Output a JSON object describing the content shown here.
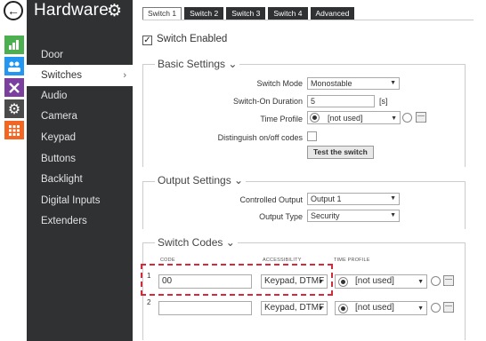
{
  "sidebar": {
    "title": "Hardware",
    "items": [
      {
        "label": "Door"
      },
      {
        "label": "Switches",
        "active": true
      },
      {
        "label": "Audio"
      },
      {
        "label": "Camera"
      },
      {
        "label": "Keypad"
      },
      {
        "label": "Buttons"
      },
      {
        "label": "Backlight"
      },
      {
        "label": "Digital Inputs"
      },
      {
        "label": "Extenders"
      }
    ]
  },
  "iconbar": {
    "colors": [
      "#4caf50",
      "#2196f3",
      "#7b3fa0",
      "#4a4a4a",
      "#f26522"
    ],
    "icons": [
      "bar-chart-icon",
      "users-icon",
      "tools-icon",
      "gear-icon",
      "grid-icon"
    ]
  },
  "tabs": [
    "Switch 1",
    "Switch 2",
    "Switch 3",
    "Switch 4",
    "Advanced"
  ],
  "switch_enabled": {
    "label": "Switch Enabled",
    "checked": true
  },
  "basic": {
    "title": "Basic Settings ⌄",
    "mode_label": "Switch Mode",
    "mode_value": "Monostable",
    "duration_label": "Switch-On Duration",
    "duration_value": "5",
    "duration_unit": "[s]",
    "profile_label": "Time Profile",
    "profile_value": "[not used]",
    "distinguish_label": "Distinguish on/off codes",
    "test_button": "Test the switch"
  },
  "output": {
    "title": "Output Settings ⌄",
    "controlled_label": "Controlled Output",
    "controlled_value": "Output 1",
    "type_label": "Output Type",
    "type_value": "Security"
  },
  "codes": {
    "title": "Switch Codes ⌄",
    "col_code": "CODE",
    "col_access": "ACCESSIBILITY",
    "col_profile": "TIME PROFILE",
    "rows": [
      {
        "num": "1",
        "code": "00",
        "access": "Keypad, DTMF",
        "profile": "[not used]"
      },
      {
        "num": "2",
        "code": "",
        "access": "Keypad, DTMF",
        "profile": "[not used]"
      }
    ]
  },
  "accent": "#d62a3c"
}
